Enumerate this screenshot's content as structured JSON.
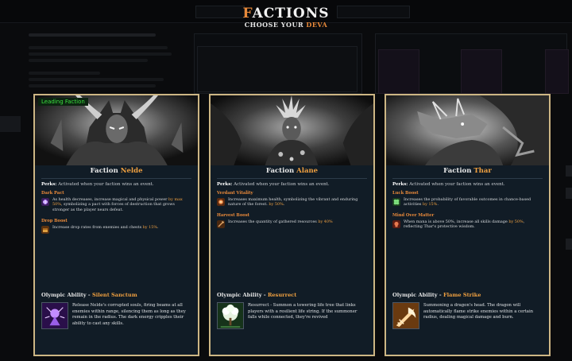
{
  "header": {
    "title_first_letter": "F",
    "title_rest": "ACTIONS",
    "subtitle_prefix": "CHOOSE YOUR ",
    "subtitle_accent": "DEVA"
  },
  "colors": {
    "accent": "#e8893a",
    "card_border": "#cdb684",
    "card_bg": "#111c26",
    "leading_tag": "#3ce040"
  },
  "cards": [
    {
      "tag": "Leading Faction",
      "name_prefix": "Faction ",
      "name": "Nelde",
      "perks_label": "Perks:",
      "perks_text": " Activated when your faction wins an event.",
      "perks": [
        {
          "title": "Dark Pact",
          "icon": "dark-pact-icon",
          "d1": "As health decreases, increase magical and physical power ",
          "d2": "by max 50%",
          "d3": ", symbolizing a pact with forces of destruction that grows stronger as the player nears defeat."
        },
        {
          "title": "Drop Boost",
          "icon": "drop-boost-icon",
          "d1": "Increase drop rates from enemies and chests ",
          "d2": "by 15%",
          "d3": "."
        }
      ],
      "ability_label": "Olympic Ability - ",
      "ability_name": "Silent Sanctum",
      "ability_icon": "silent-sanctum-icon",
      "ability_desc": "Release Nelde's corrupted souls, firing beams at all enemies within range, silencing them as long as they remain in the radius. The dark energy cripples their ability to cast any skills."
    },
    {
      "tag": "",
      "name_prefix": "Faction ",
      "name": "Alane",
      "perks_label": "Perks:",
      "perks_text": " Activated when your faction wins an event.",
      "perks": [
        {
          "title": "Verdant Vitality",
          "icon": "verdant-vitality-icon",
          "d1": "Increases maximum health, symbolizing the vibrant and enduring nature of the forest. ",
          "d2": "by 50%",
          "d3": "."
        },
        {
          "title": "Harvest Boost",
          "icon": "harvest-boost-icon",
          "d1": "Increases the quantity of gathered resources ",
          "d2": "by 40%",
          "d3": ""
        }
      ],
      "ability_label": "Olympic Ability - ",
      "ability_name": "Resurrect",
      "ability_icon": "resurrect-icon",
      "ability_desc": "Resurrect - Summon a towering life tree that links players with a resilient life string. If the summoner falls while connected, they're revived"
    },
    {
      "tag": "",
      "name_prefix": "Faction ",
      "name": "Thar",
      "perks_label": "Perks:",
      "perks_text": " Activated when your faction wins an event.",
      "perks": [
        {
          "title": "Luck Boost",
          "icon": "luck-boost-icon",
          "d1": "Increases the probability of favorable outcomes in chance-based activities ",
          "d2": "by 15%",
          "d3": "."
        },
        {
          "title": "Mind Over Matter",
          "icon": "mind-over-matter-icon",
          "d1": "When mana is above 50%, increase all skills damage ",
          "d2": "by 50%",
          "d3": ", reflecting Thar's protective wisdom."
        }
      ],
      "ability_label": "Olympic Ability - ",
      "ability_name": "Flame Strike",
      "ability_icon": "flame-strike-icon",
      "ability_desc": "Summoning a dragon's head. The dragon will automatically flame strike enemies within a certain radius, dealing magical damage and burn."
    }
  ]
}
